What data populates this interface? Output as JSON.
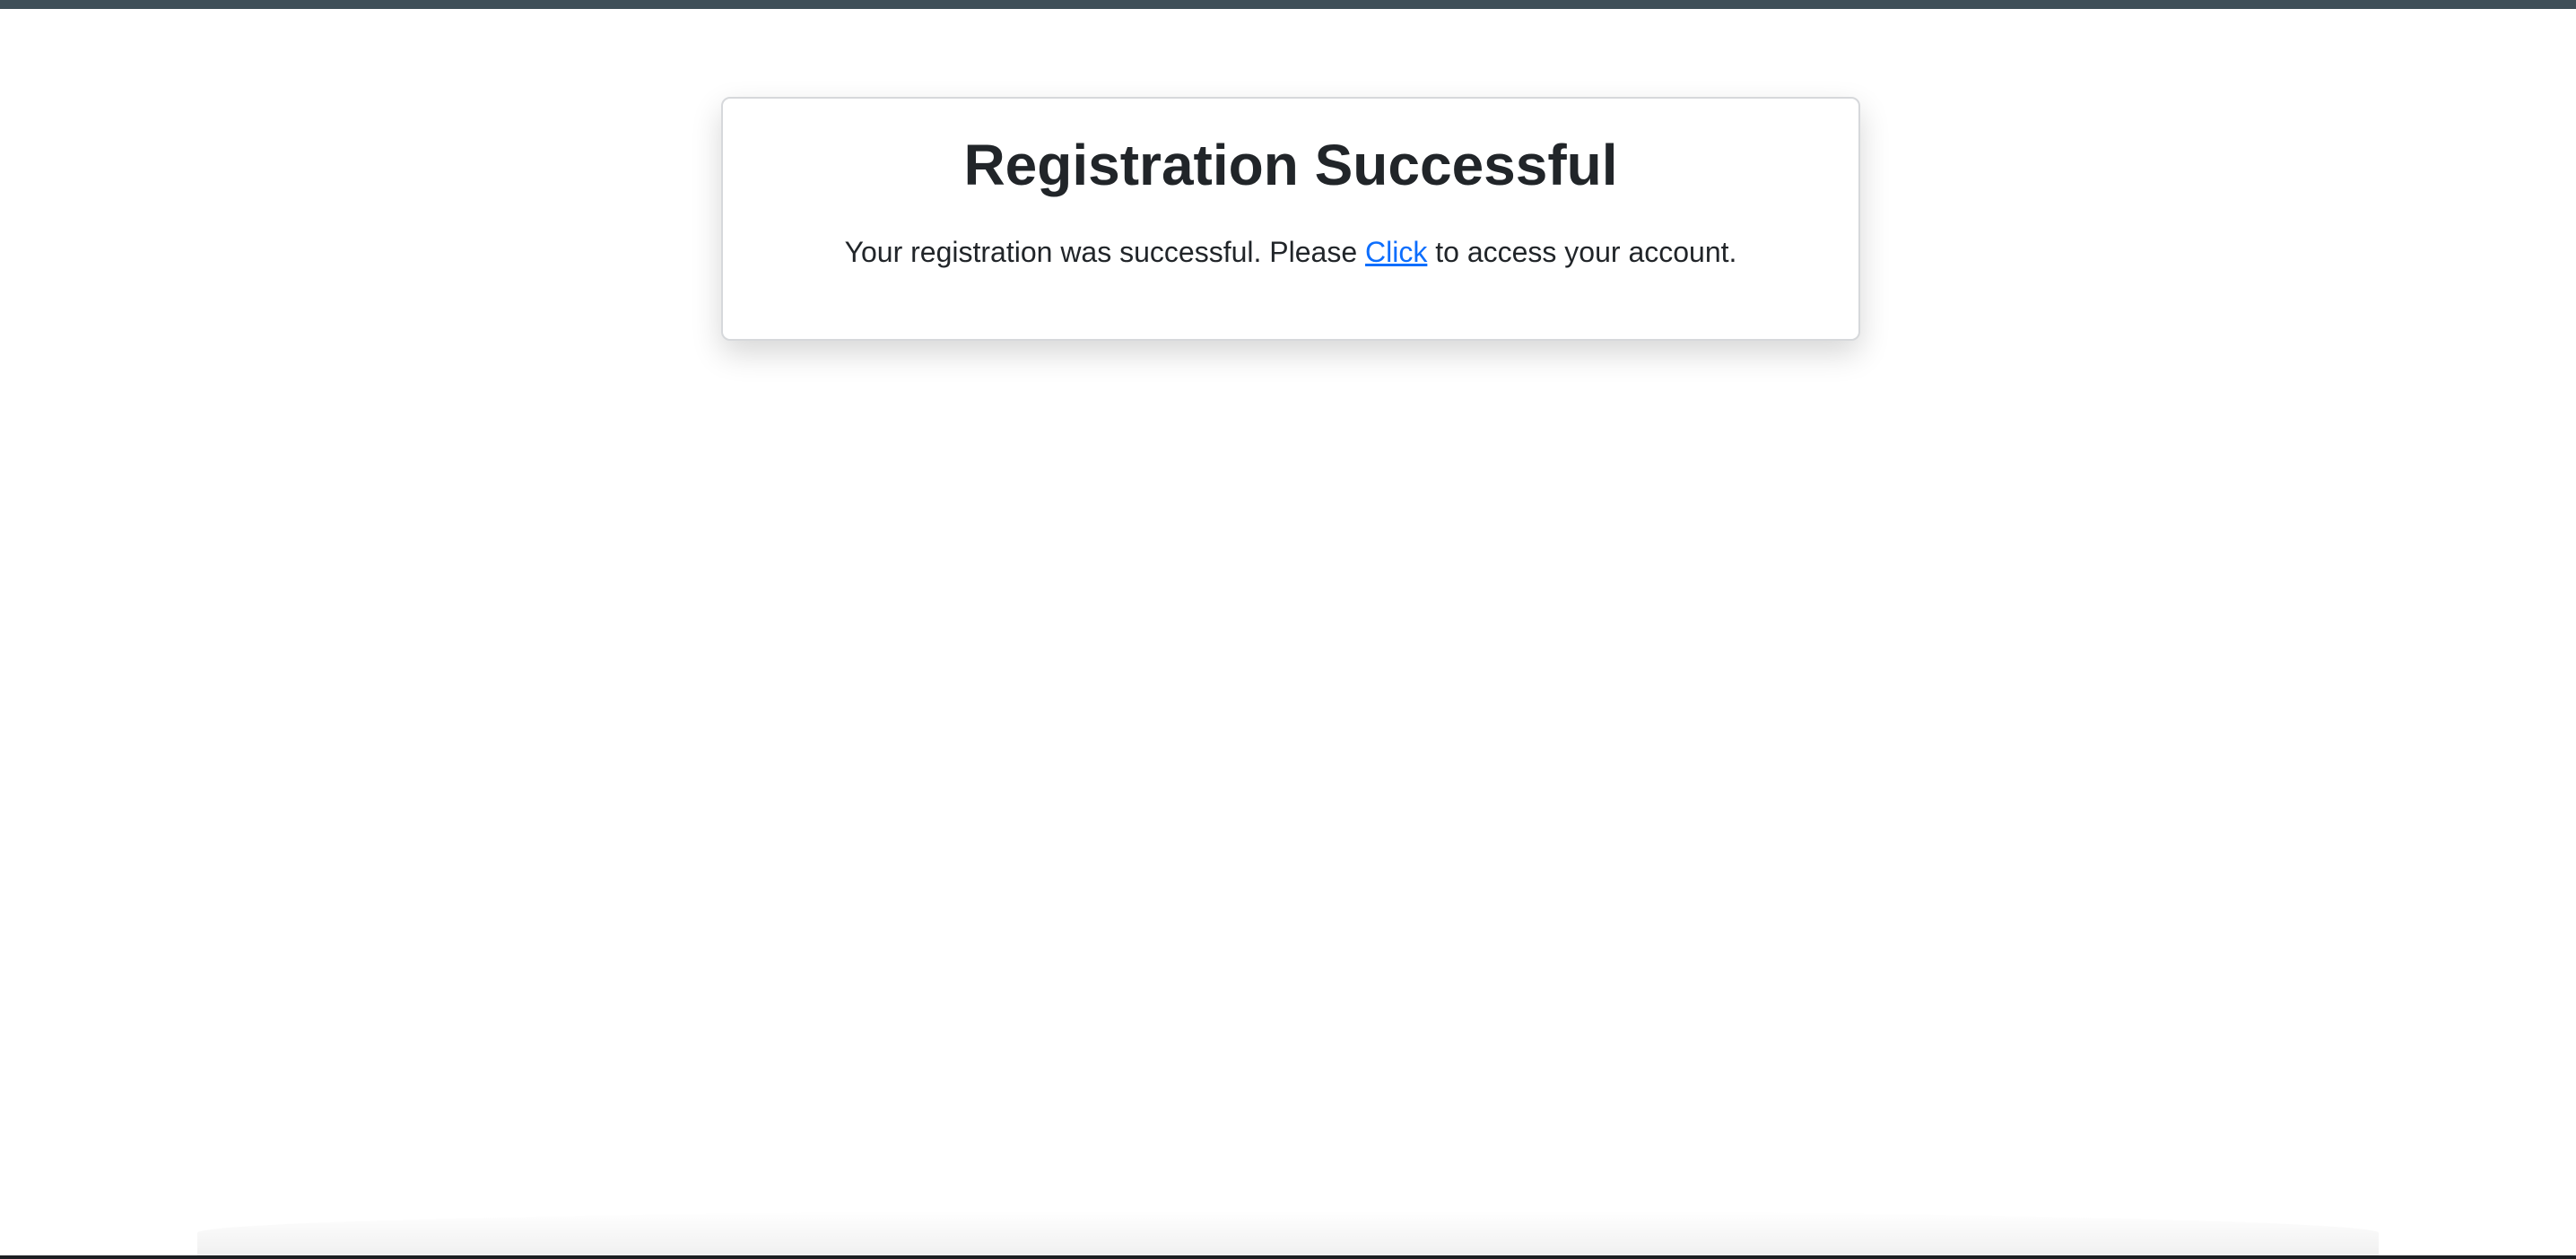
{
  "page": {
    "title": "Registration Successful",
    "message_before": "Your registration was successful. Please ",
    "link_label": "Click",
    "message_after": " to access your account."
  },
  "colors": {
    "top_bar": "#3f4f58",
    "link": "#0d6efd",
    "text": "#212529"
  }
}
